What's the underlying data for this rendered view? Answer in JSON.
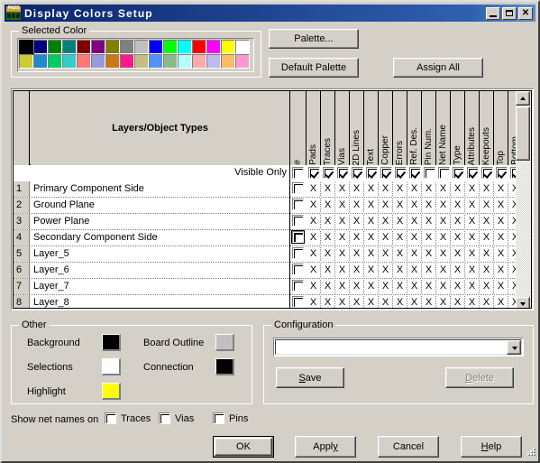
{
  "window": {
    "title": "Display Colors Setup",
    "icon": "pads-app-icon",
    "buttons": {
      "minimize": "minimize-icon",
      "maximize": "maximize-icon",
      "close": "close-icon"
    }
  },
  "selected_color": {
    "group_label": "Selected Color",
    "selected_index": 0,
    "row1": [
      "#000000",
      "#000080",
      "#008000",
      "#008080",
      "#800000",
      "#800080",
      "#808000",
      "#808080",
      "#c0c0c0",
      "#0000ff",
      "#00ff00",
      "#00ffff",
      "#ff0000",
      "#ff00ff",
      "#ffff00",
      "#ffffff"
    ],
    "row2": [
      "#cccc33",
      "#2288cc",
      "#00cc66",
      "#33cccc",
      "#ff7777",
      "#9999dd",
      "#cc7711",
      "#ff1a8c",
      "#c4be82",
      "#4d94ff",
      "#88bb88",
      "#b3ffff",
      "#ffaaaa",
      "#bbbbee",
      "#ffbb66",
      "#ff99cc"
    ]
  },
  "toolbar": {
    "palette": "Palette...",
    "default_palette": "Default Palette",
    "assign_all": "Assign All"
  },
  "table": {
    "title_header": "Layers/Object Types",
    "columns": [
      "#",
      "Pads",
      "Traces",
      "Vias",
      "2D Lines",
      "Text",
      "Copper",
      "Errors",
      "Ref. Des.",
      "Pin Num.",
      "Net Name",
      "Type",
      "Attributes",
      "Keepouts",
      "Top",
      "Bottom"
    ],
    "visible_only_label": "Visible Only",
    "visible_only_checks": [
      false,
      true,
      true,
      true,
      true,
      true,
      true,
      true,
      true,
      false,
      false,
      true,
      true,
      true,
      true,
      true
    ],
    "mark": "X",
    "rows": [
      {
        "num": "1",
        "name": "Primary Component Side",
        "checked": false,
        "focused": false
      },
      {
        "num": "2",
        "name": "Ground Plane",
        "checked": false,
        "focused": false
      },
      {
        "num": "3",
        "name": "Power Plane",
        "checked": false,
        "focused": false
      },
      {
        "num": "4",
        "name": "Secondary Component Side",
        "checked": false,
        "focused": true
      },
      {
        "num": "5",
        "name": "Layer_5",
        "checked": false,
        "focused": false
      },
      {
        "num": "6",
        "name": "Layer_6",
        "checked": false,
        "focused": false
      },
      {
        "num": "7",
        "name": "Layer_7",
        "checked": false,
        "focused": false
      },
      {
        "num": "8",
        "name": "Layer_8",
        "checked": false,
        "focused": false
      }
    ],
    "scrollbar": {
      "up": "scroll-up-arrow",
      "down": "scroll-down-arrow"
    }
  },
  "other": {
    "group_label": "Other",
    "items": [
      {
        "label": "Background",
        "color": "#000000"
      },
      {
        "label": "Selections",
        "color": "#ffffff"
      },
      {
        "label": "Highlight",
        "color": "#ffff00"
      },
      {
        "label": "Board Outline",
        "color": "#c0c0c0"
      },
      {
        "label": "Connection",
        "color": "#000000"
      }
    ]
  },
  "configuration": {
    "group_label": "Configuration",
    "value": "",
    "placeholder": "",
    "save": "Save",
    "delete": "Delete",
    "delete_enabled": false
  },
  "net_names": {
    "label": "Show net names on",
    "options": [
      {
        "label": "Traces",
        "checked": false
      },
      {
        "label": "Vias",
        "checked": false
      },
      {
        "label": "Pins",
        "checked": false
      }
    ]
  },
  "footer": {
    "ok": "OK",
    "apply": "Apply",
    "cancel": "Cancel",
    "help": "Help"
  }
}
